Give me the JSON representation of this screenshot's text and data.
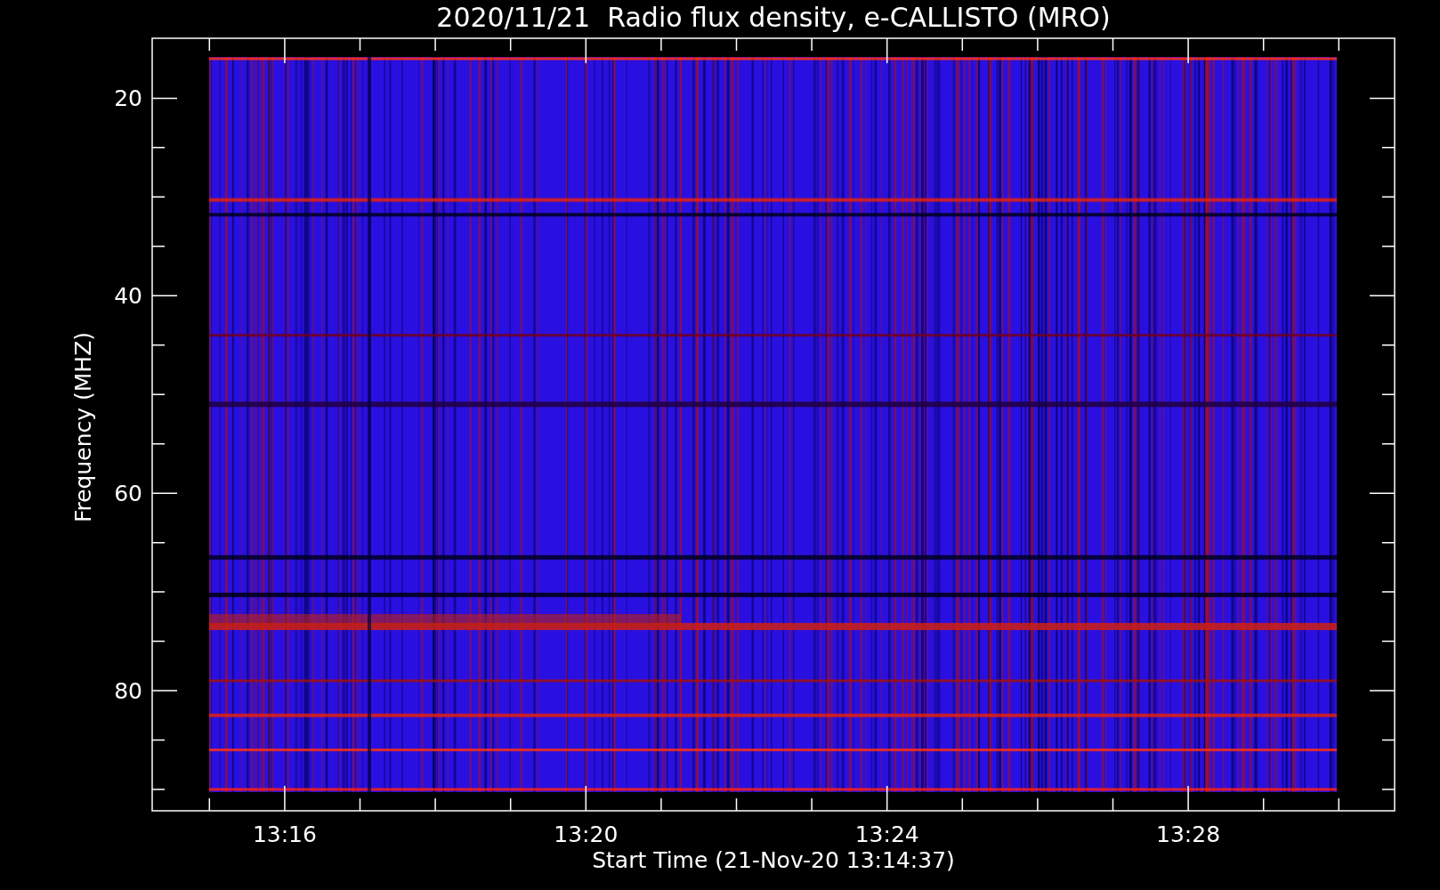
{
  "chart": {
    "title": "2020/11/21  Radio flux density, e-CALLISTO (MRO)",
    "ylabel": "Frequency (MHZ)",
    "xlabel": "Start Time (21-Nov-20 13:14:37)",
    "yticks": [
      "20",
      "40",
      "60",
      "80"
    ],
    "xticks": [
      "13:16",
      "13:20",
      "13:24",
      "13:28"
    ]
  }
}
